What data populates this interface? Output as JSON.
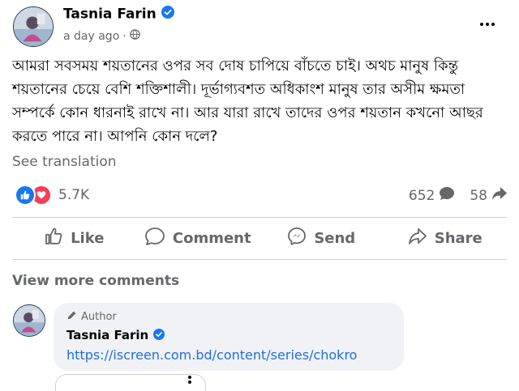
{
  "post": {
    "author": "Tasnia Farin",
    "time": "a day ago",
    "time_separator": "·",
    "text": "আমরা সবসময় শয়তানের ওপর সব দোষ চাপিয়ে বাঁচতে চাই। অথচ মানুষ কিন্তু শয়তানের চেয়ে বেশি শক্তিশালী। দূর্ভাগ্যবশত অধিকাংশ মানুষ তার অসীম ক্ষমতা সম্পর্কে কোন ধারনাই রাখে না। আর যারা রাখে তাদের ওপর শয়তান কখনো আছর করতে পারে না। আপনি কোন দলে?",
    "see_translation": "See translation"
  },
  "stats": {
    "reactions": "5.7K",
    "comments": "652",
    "shares": "58"
  },
  "actions": {
    "like": "Like",
    "comment": "Comment",
    "send": "Send",
    "share": "Share"
  },
  "comments": {
    "view_more": "View more comments",
    "items": [
      {
        "badge": "Author",
        "name": "Tasnia Farin",
        "text": "https://iscreen.com.bd/content/series/chokro"
      }
    ]
  },
  "colors": {
    "accent": "#1877f2",
    "love": "#f33e58",
    "secondary_text": "#65676b",
    "link": "#216fdb",
    "bubble": "#f0f2f5"
  },
  "icons": [
    "profile-avatar",
    "verified-badge-icon",
    "globe-icon",
    "more-icon",
    "like-reaction-icon",
    "love-reaction-icon",
    "comment-count-icon",
    "share-count-icon",
    "like-icon",
    "comment-icon",
    "messenger-icon",
    "share-icon",
    "pencil-icon"
  ]
}
